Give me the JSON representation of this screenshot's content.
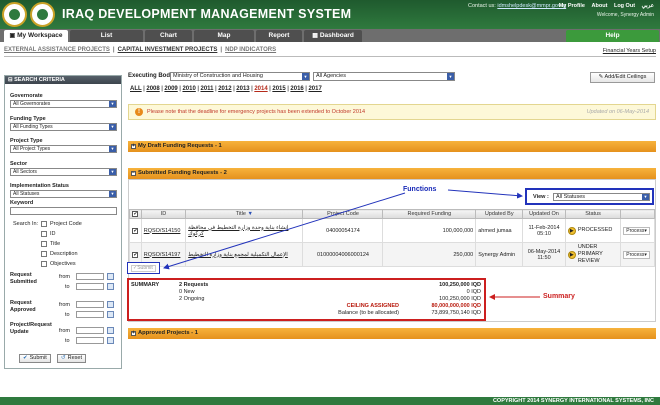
{
  "header": {
    "title": "IRAQ DEVELOPMENT MANAGEMENT SYSTEM",
    "contact_prefix": "Contact us:",
    "contact_email": "idmshelpdesk@mmpr.gov.iq",
    "links": [
      "My Profile",
      "About",
      "Log Out",
      "عربي"
    ],
    "welcome": "Welcome, Synergy Admin"
  },
  "nav": {
    "tabs": [
      "My Workspace",
      "List",
      "Chart",
      "Map",
      "Report",
      "Dashboard"
    ],
    "help": "Help"
  },
  "subnav": {
    "items": [
      "EXTERNAL ASSISTANCE PROJECTS",
      "CAPITAL INVESTMENT PROJECTS",
      "NDP INDICATORS"
    ],
    "financial_setup": "Financial Years Setup"
  },
  "sidebar": {
    "title": "SEARCH CRITERIA",
    "governorate_label": "Governorate",
    "governorate_value": "All Governorates",
    "funding_type_label": "Funding Type",
    "funding_type_value": "All Funding Types",
    "project_type_label": "Project Type",
    "project_type_value": "All Project Types",
    "sector_label": "Sector",
    "sector_value": "All Sectors",
    "impl_status_label": "Implementation Status",
    "impl_status_value": "All Statuses",
    "keyword_label": "Keyword",
    "search_in_label": "Search In:",
    "search_in_options": [
      "Project Code",
      "ID",
      "Title",
      "Description",
      "Objectives"
    ],
    "req_submitted_label": "Request Submitted",
    "req_approved_label": "Request Approved",
    "proj_update_label": "Project/Request Update",
    "from_label": "from",
    "to_label": "to",
    "submit": "Submit",
    "reset": "Reset"
  },
  "main": {
    "exec_body_label": "Executing Body",
    "exec_body_value": "Ministry of Construction and Housing",
    "agency_value": "All Agencies",
    "add_ceilings": "Add/Edit Ceilings",
    "years": [
      "ALL",
      "2008",
      "2009",
      "2010",
      "2011",
      "2012",
      "2013",
      "2014",
      "2015",
      "2016",
      "2017"
    ],
    "current_year": "2014",
    "notice": "Please note that the deadline for emergency projects has been extended to October 2014",
    "notice_updated": "Updated on 06-May-2014",
    "draft_bar": "My Draft Funding Requests - 1",
    "submitted_bar": "Submitted Funding Requests - 2",
    "approved_bar": "Approved Projects - 1",
    "view_label": "View :",
    "view_value": "All Statuses",
    "columns": [
      "ID",
      "Title",
      "Project Code",
      "Required Funding",
      "Updated By",
      "Updated On",
      "Status"
    ],
    "rows": [
      {
        "id": "RQSO/S14150",
        "title": "انشاء بناية وحدة وزارة التخطيط في محافظة كركوك",
        "code": "04000054174",
        "funding": "100,000,000",
        "updated_by": "ahmed jumaa",
        "date": "11-Feb-2014",
        "time": "05:10",
        "status": "PROCESSED",
        "action": "Process"
      },
      {
        "id": "RQSO/S14197",
        "title": "الإعمال التكميلية لمجمع بناية وزارة التخطيط",
        "code": "01000004006000124",
        "funding": "250,000",
        "updated_by": "Synergy Admin",
        "date": "06-May-2014",
        "time": "11:50",
        "status": "UNDER PRIMARY REVIEW",
        "action": "Process"
      }
    ],
    "submit_disabled": "Submit",
    "functions_label": "Functions",
    "summary_label": "Summary",
    "summary": {
      "title": "SUMMARY",
      "requests": "2 Requests",
      "new": "0 New",
      "ongoing": "2 Ongoing",
      "ceiling_label": "CEILING ASSIGNED",
      "balance_label": "Balance (to be allocated)",
      "requests_amt": "100,250,000 IQD",
      "new_amt": "0 IQD",
      "ongoing_amt": "100,250,000 IQD",
      "ceiling_amt": "80,000,000,000 IQD",
      "balance_amt": "73,899,750,140 IQD"
    }
  },
  "footer": "COPYRIGHT 2014 SYNERGY INTERNATIONAL SYSTEMS, INC"
}
